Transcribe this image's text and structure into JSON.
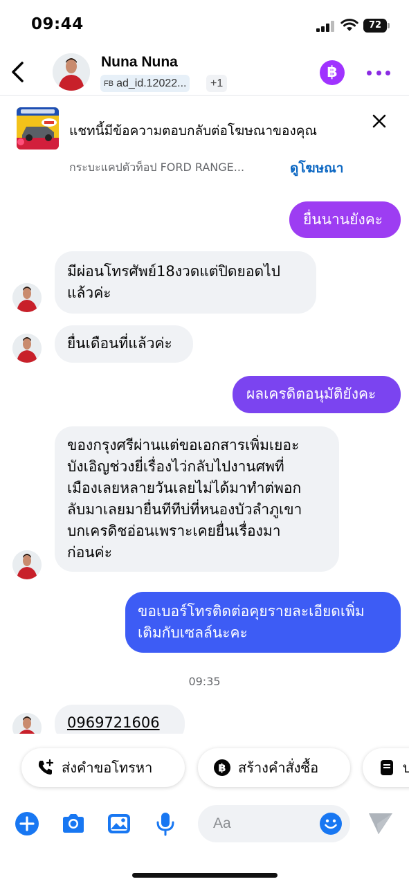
{
  "status_bar": {
    "time": "09:44",
    "battery": "72"
  },
  "header": {
    "contact_name": "Nuna Nuna",
    "fb_tag": "FB",
    "ad_id": "ad_id.12022...",
    "extra_count": "+1",
    "baht_symbol": "฿"
  },
  "ad_banner": {
    "message": "แชทนี้มีข้อความตอบกลับต่อโฆษณาของคุณ",
    "product": "กระบะแคปตัวท็อป FORD RANGE...",
    "view_link": "ดูโฆษณา"
  },
  "messages": [
    {
      "sender": "me",
      "text": "ยื่นนานยังคะ"
    },
    {
      "sender": "contact",
      "lines": [
        "มีผ่อนโทรศัพย์18งวดแต่ปิดยอดไป",
        "แล้วค่ะ"
      ]
    },
    {
      "sender": "contact",
      "text": "ยื่นเดือนที่แล้วค่ะ"
    },
    {
      "sender": "me",
      "text": "ผลเครดิตอนุมัติยังคะ"
    },
    {
      "sender": "contact",
      "lines": [
        "ของกรุงศรีผ่านแต่ขอเอกสารเพิ่มเยอะ",
        "บังเอิญช่วงยี่เรื่องไว่กลับไปงานศพที่",
        "เมืองเลยหลายวันเลยไม่ได้มาทำต่พอก",
        "ลับมาเลยมายื่นทีทีบ่ที่หนองบัวลำภูเขา",
        "บกเครดิชอ่อนเพราะเคยยื่นเรื่องมา",
        "ก่อนค่ะ"
      ]
    },
    {
      "sender": "me",
      "lines": [
        "ขอเบอร์โทรติดต่อคุยรายละเอียดเพิ่ม",
        "เติมกับเซลล์นะคะ"
      ]
    },
    {
      "timestamp": "09:35"
    },
    {
      "sender": "contact",
      "text": "0969721606"
    }
  ],
  "quick_actions": [
    {
      "label": "ส่งคำขอโทรหา",
      "icon": "phone-plus-icon"
    },
    {
      "label": "สร้างคำสั่งซื้อ",
      "icon": "baht-icon"
    },
    {
      "label": "บ",
      "icon": "document-icon"
    }
  ],
  "composer": {
    "placeholder": "Aa"
  },
  "colors": {
    "accent_purple": "#a033ff",
    "outgoing_purple": "#9d3df2",
    "outgoing_violet": "#7b44f0",
    "outgoing_blue": "#3d5cf5",
    "incoming_bubble": "#f0f2f5",
    "icon_blue": "#1877f2",
    "link_blue": "#0a66c2"
  }
}
